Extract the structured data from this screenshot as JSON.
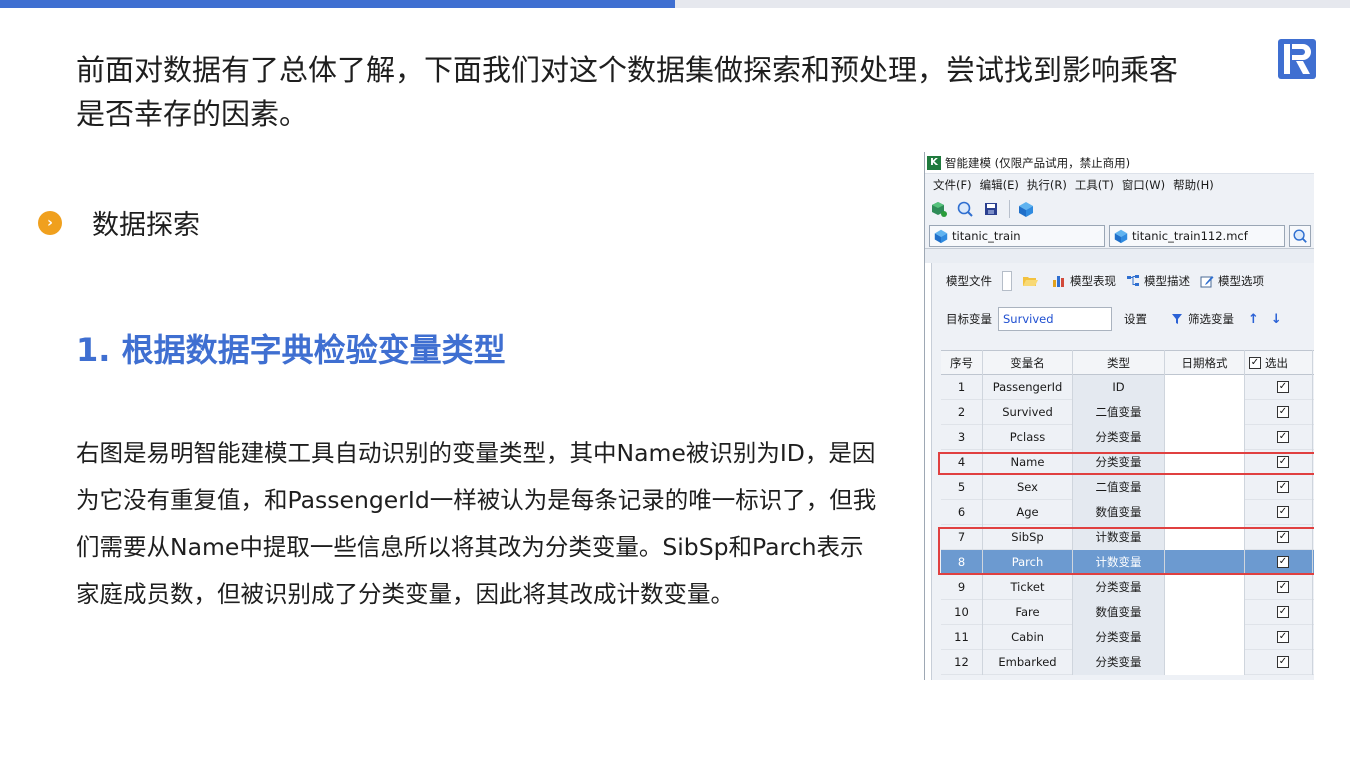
{
  "slide": {
    "intro": "前面对数据有了总体了解，下面我们对这个数据集做探索和预处理，尝试找到影响乘客是否幸存的因素。",
    "section_label": "数据探索",
    "heading": "1. 根据数据字典检验变量类型",
    "body": "右图是易明智能建模工具自动识别的变量类型，其中Name被识别为ID，是因为它没有重复值，和PassengerId一样被认为是每条记录的唯一标识了，但我们需要从Name中提取一些信息所以将其改为分类变量。SibSp和Parch表示家庭成员数，但被识别成了分类变量，因此将其改成计数变量。",
    "accent_color": "#3f6fd1",
    "bullet_color": "#f0a01e"
  },
  "app": {
    "title": "智能建模 (仅限产品试用，禁止商用)",
    "menu": [
      "文件(F)",
      "编辑(E)",
      "执行(R)",
      "工具(T)",
      "窗口(W)",
      "帮助(H)"
    ],
    "tabs": [
      "titanic_train",
      "titanic_train112.mcf"
    ],
    "panel_tools": {
      "model_file": "模型文件",
      "model_perf": "模型表现",
      "model_desc": "模型描述",
      "model_opts": "模型选项"
    },
    "target_label": "目标变量",
    "target_value": "Survived",
    "settings": "设置",
    "filter": "筛选变量",
    "up_arrow": "↑",
    "down_arrow": "↓",
    "columns": [
      "序号",
      "变量名",
      "类型",
      "日期格式",
      "选出"
    ],
    "rows": [
      {
        "no": "1",
        "name": "PassengerId",
        "type": "ID"
      },
      {
        "no": "2",
        "name": "Survived",
        "type": "二值变量"
      },
      {
        "no": "3",
        "name": "Pclass",
        "type": "分类变量"
      },
      {
        "no": "4",
        "name": "Name",
        "type": "分类变量"
      },
      {
        "no": "5",
        "name": "Sex",
        "type": "二值变量"
      },
      {
        "no": "6",
        "name": "Age",
        "type": "数值变量"
      },
      {
        "no": "7",
        "name": "SibSp",
        "type": "计数变量"
      },
      {
        "no": "8",
        "name": "Parch",
        "type": "计数变量"
      },
      {
        "no": "9",
        "name": "Ticket",
        "type": "分类变量"
      },
      {
        "no": "10",
        "name": "Fare",
        "type": "数值变量"
      },
      {
        "no": "11",
        "name": "Cabin",
        "type": "分类变量"
      },
      {
        "no": "12",
        "name": "Embarked",
        "type": "分类变量"
      }
    ],
    "check_mark": "✓"
  }
}
